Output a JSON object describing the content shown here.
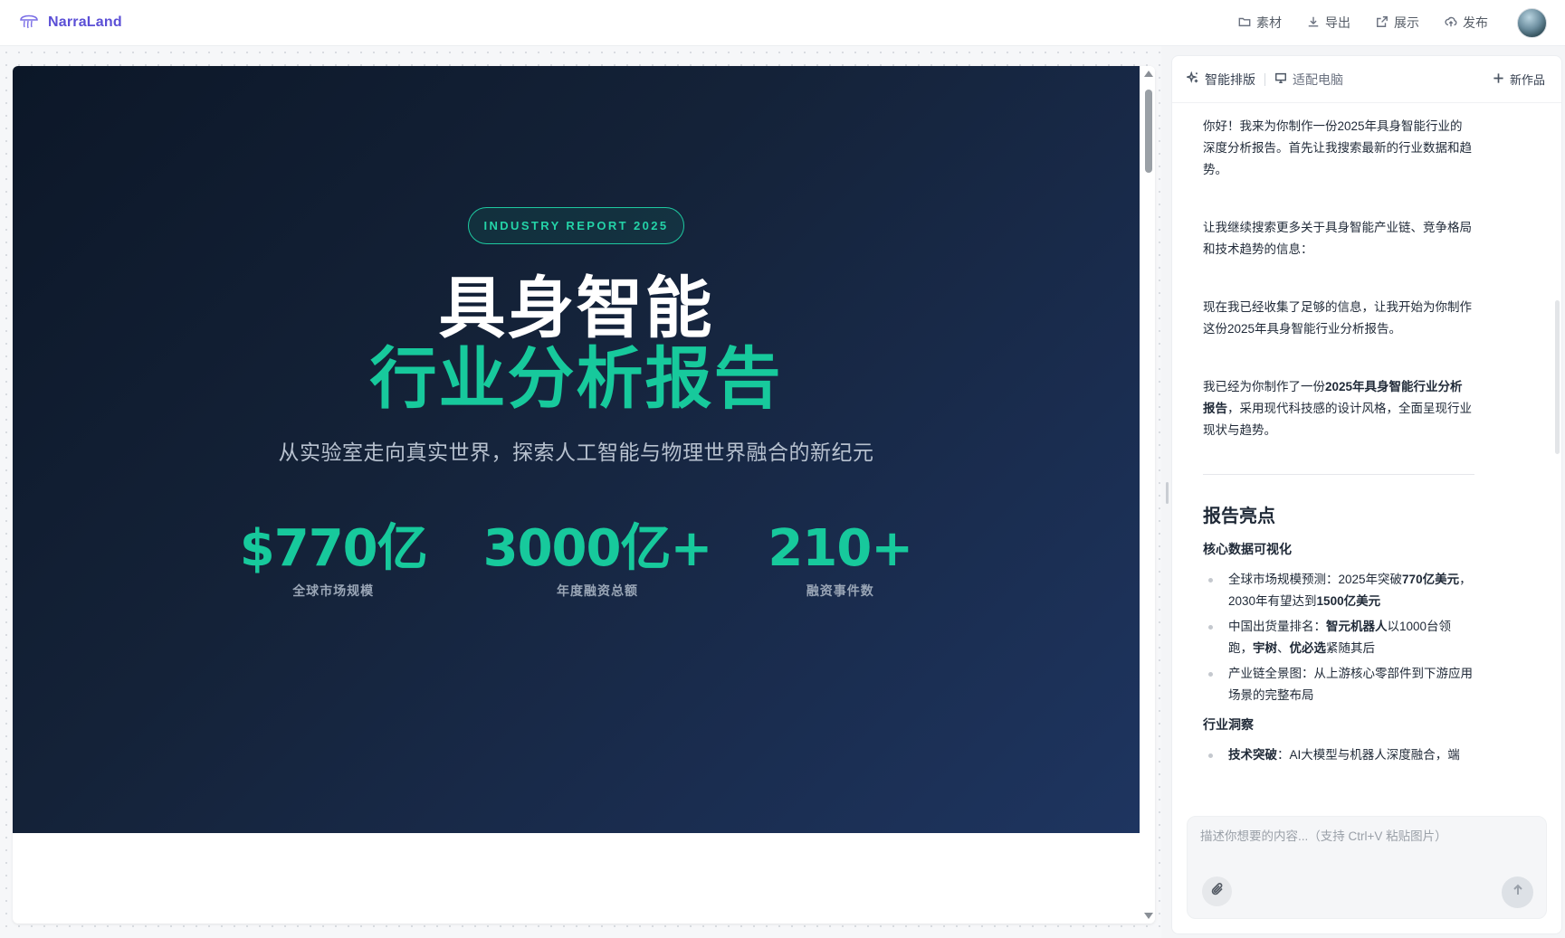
{
  "app": {
    "brand": "NarraLand"
  },
  "topbar": {
    "actions": [
      {
        "label": "素材",
        "icon": "folder-icon"
      },
      {
        "label": "导出",
        "icon": "download-icon"
      },
      {
        "label": "展示",
        "icon": "external-link-icon"
      },
      {
        "label": "发布",
        "icon": "upload-cloud-icon"
      }
    ]
  },
  "slide": {
    "badge": "INDUSTRY REPORT 2025",
    "title_line1": "具身智能",
    "title_line2": "行业分析报告",
    "subtitle": "从实验室走向真实世界，探索人工智能与物理世界融合的新纪元",
    "stats": [
      {
        "value": "$770亿",
        "label": "全球市场规模"
      },
      {
        "value": "3000亿+",
        "label": "年度融资总额"
      },
      {
        "value": "210+",
        "label": "融资事件数"
      }
    ],
    "colors": {
      "accent": "#17c99c",
      "bg_start": "#0c1728",
      "bg_end": "#1e3560"
    }
  },
  "panel": {
    "tabs": [
      {
        "label": "智能排版",
        "icon": "sparkle-icon"
      },
      {
        "label": "适配电脑",
        "icon": "monitor-icon"
      }
    ],
    "new_button": "新作品",
    "messages": {
      "m1": "你好！我来为你制作一份2025年具身智能行业的深度分析报告。首先让我搜索最新的行业数据和趋势。",
      "m2": "让我继续搜索更多关于具身智能产业链、竞争格局和技术趋势的信息：",
      "m3": "现在我已经收集了足够的信息，让我开始为你制作这份2025年具身智能行业分析报告。",
      "m4_pre": "我已经为你制作了一份",
      "m4_bold": "2025年具身智能行业分析报告",
      "m4_post": "，采用现代科技感的设计风格，全面呈现行业现状与趋势。"
    },
    "highlights": {
      "heading": "报告亮点",
      "section1": "核心数据可视化",
      "b1_pre": "全球市场规模预测：2025年突破",
      "b1_bold1": "770亿美元",
      "b1_mid": "，2030年有望达到",
      "b1_bold2": "1500亿美元",
      "b2_pre": "中国出货量排名：",
      "b2_bold1": "智元机器人",
      "b2_mid": "以1000台领跑，",
      "b2_bold2": "宇树",
      "b2_sep": "、",
      "b2_bold3": "优必选",
      "b2_post": "紧随其后",
      "b3": "产业链全景图：从上游核心零部件到下游应用场景的完整布局",
      "section2": "行业洞察",
      "b4_bold": "技术突破",
      "b4_post": "：AI大模型与机器人深度融合，端"
    },
    "input": {
      "placeholder": "描述你想要的内容...（支持 Ctrl+V 粘贴图片）"
    }
  }
}
